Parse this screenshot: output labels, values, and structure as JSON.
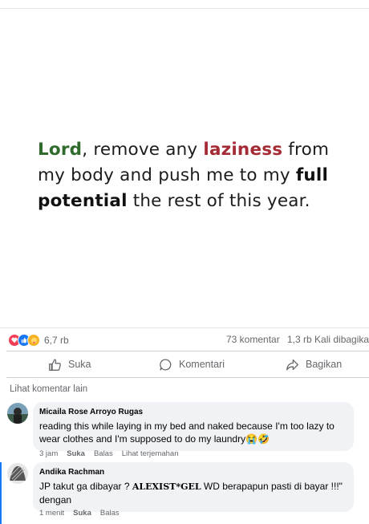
{
  "post": {
    "quote": {
      "w1": "Lord",
      "w2": ", remove any ",
      "w3": "laziness",
      "w4": " from my body and push me to my ",
      "w5": "full potential",
      "w6": " the rest of this year."
    },
    "colors": {
      "green": "#2f6b2d",
      "red": "#a42a35",
      "accent": "#1877f2"
    }
  },
  "stats": {
    "reaction_icons": [
      "love-icon",
      "like-icon",
      "care-icon"
    ],
    "reaction_count": "6,7 rb",
    "comment_count": "73 komentar",
    "share_count": "1,3 rb Kali dibagikan"
  },
  "actions": {
    "like_label": "Suka",
    "comment_label": "Komentari",
    "share_label": "Bagikan"
  },
  "comments_section": {
    "more_label": "Lihat komentar lain",
    "items": [
      {
        "name": "Micaila Rose Arroyo Rugas",
        "text": "reading this while laying in my bed and naked because I'm too lazy to wear clothes and I'm supposed to do my laundry😭🤣",
        "time": "3 jam",
        "like": "Suka",
        "reply": "Balas",
        "translate": "Lihat terjemahan"
      },
      {
        "name": "Andika Rachman",
        "text_pre": "JP takut ga dibayar ? ",
        "text_serif": "ALEXIST*GEL",
        "text_post": " WD berapapun pasti di bayar !!!\" dengan",
        "time": "1 menit",
        "like": "Suka",
        "reply": "Balas"
      }
    ]
  }
}
